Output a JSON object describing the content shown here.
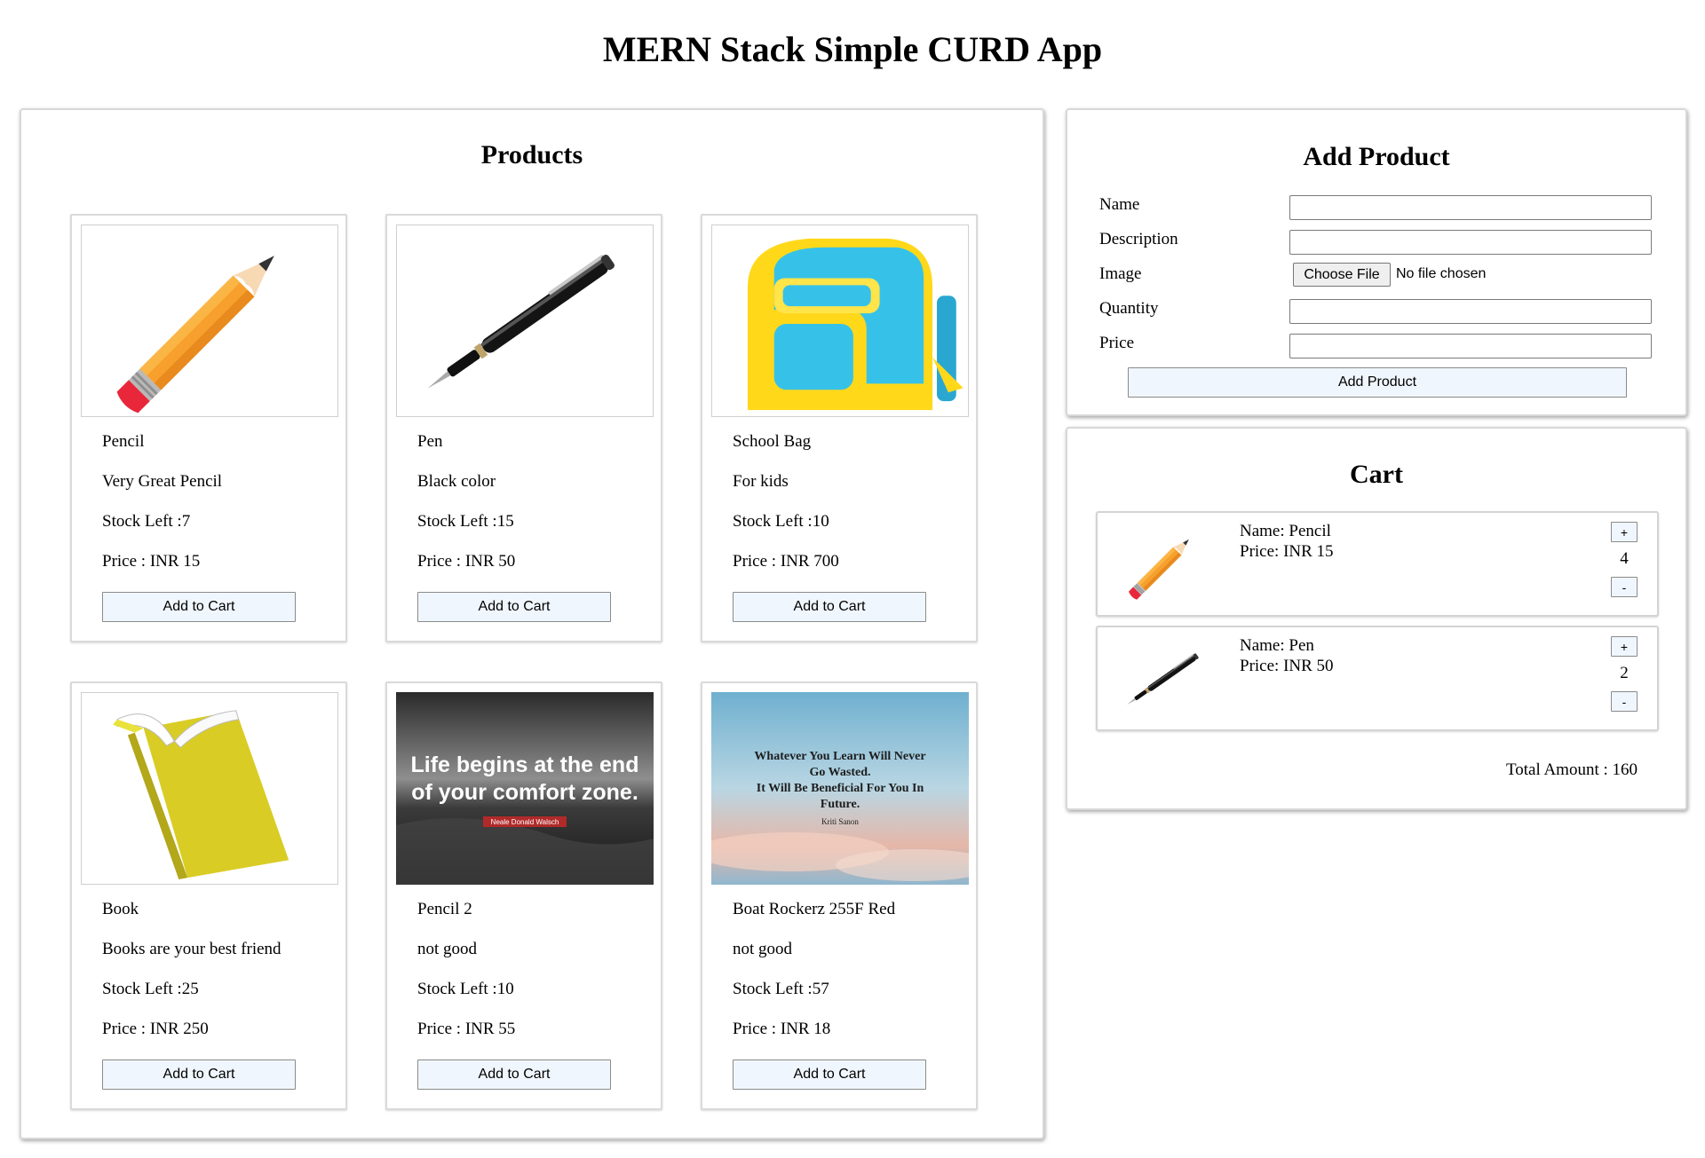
{
  "app": {
    "title": "MERN Stack Simple CURD App"
  },
  "products_panel": {
    "title": "Products",
    "items": [
      {
        "name": "Pencil",
        "description": "Very Great Pencil",
        "stock": "Stock Left :7",
        "price": "Price : INR 15",
        "button": "Add to Cart",
        "image": "pencil-image"
      },
      {
        "name": "Pen",
        "description": "Black color",
        "stock": "Stock Left :15",
        "price": "Price : INR 50",
        "button": "Add to Cart",
        "image": "pen-image"
      },
      {
        "name": "School Bag",
        "description": "For kids",
        "stock": "Stock Left :10",
        "price": "Price : INR 700",
        "button": "Add to Cart",
        "image": "school-bag-image"
      },
      {
        "name": "Book",
        "description": "Books are your best friend",
        "stock": "Stock Left :25",
        "price": "Price : INR 250",
        "button": "Add to Cart",
        "image": "book-image"
      },
      {
        "name": "Pencil 2",
        "description": "not good",
        "stock": "Stock Left :10",
        "price": "Price : INR 55",
        "button": "Add to Cart",
        "image": "quote-poster-image",
        "image_text": {
          "quote": [
            "Life begins at the end",
            "of your comfort zone."
          ],
          "author": "Neale Donald Walsch"
        }
      },
      {
        "name": "Boat Rockerz 255F Red",
        "description": "not good",
        "stock": "Stock Left :57",
        "price": "Price : INR 18",
        "button": "Add to Cart",
        "image": "sky-quote-image",
        "image_text": {
          "quote": [
            "Whatever You Learn Will Never",
            "Go Wasted.",
            "It Will Be Beneficial For You In",
            "Future."
          ],
          "author": "Kriti Sanon"
        }
      }
    ]
  },
  "add_product": {
    "title": "Add Product",
    "fields": {
      "name": {
        "label": "Name",
        "value": ""
      },
      "description": {
        "label": "Description",
        "value": ""
      },
      "image": {
        "label": "Image",
        "button": "Choose File",
        "status": "No file chosen"
      },
      "quantity": {
        "label": "Quantity",
        "value": ""
      },
      "price": {
        "label": "Price",
        "value": ""
      }
    },
    "submit_label": "Add Product"
  },
  "cart": {
    "title": "Cart",
    "items": [
      {
        "name": "Name: Pencil",
        "price": "Price: INR 15",
        "quantity": "4",
        "plus": "+",
        "minus": "-",
        "image": "pencil-image"
      },
      {
        "name": "Name: Pen",
        "price": "Price: INR 50",
        "quantity": "2",
        "plus": "+",
        "minus": "-",
        "image": "pen-image"
      }
    ],
    "total": "Total Amount : 160"
  }
}
